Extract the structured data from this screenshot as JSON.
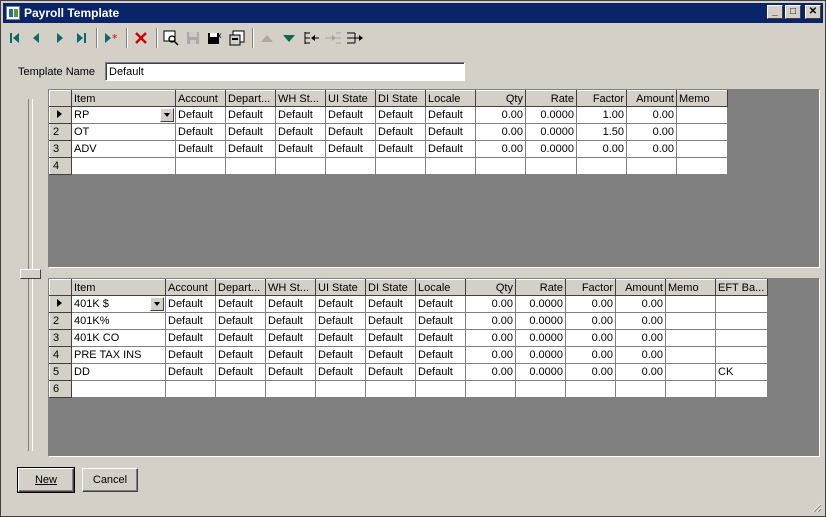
{
  "window": {
    "title": "Payroll Template"
  },
  "toolbar": {
    "icons": [
      "first-record-icon",
      "prev-record-icon",
      "next-record-icon",
      "last-record-icon",
      "new-record-icon",
      "delete-record-icon",
      "find-icon",
      "save-icon",
      "save-close-icon",
      "properties-icon",
      "move-up-icon",
      "move-down-icon",
      "insert-row-icon",
      "indent-icon",
      "outdent-icon"
    ]
  },
  "template_name": {
    "label": "Template Name",
    "value": "Default"
  },
  "grid1": {
    "columns": [
      "Item",
      "Account",
      "Depart...",
      "WH St...",
      "UI State",
      "DI State",
      "Locale",
      "Qty",
      "Rate",
      "Factor",
      "Amount",
      "Memo"
    ],
    "rows": [
      {
        "n": "1",
        "item": "RP",
        "account": "Default",
        "dept": "Default",
        "wh": "Default",
        "ui": "Default",
        "di": "Default",
        "locale": "Default",
        "qty": "0.00",
        "rate": "0.0000",
        "factor": "1.00",
        "amount": "0.00",
        "memo": ""
      },
      {
        "n": "2",
        "item": "OT",
        "account": "Default",
        "dept": "Default",
        "wh": "Default",
        "ui": "Default",
        "di": "Default",
        "locale": "Default",
        "qty": "0.00",
        "rate": "0.0000",
        "factor": "1.50",
        "amount": "0.00",
        "memo": ""
      },
      {
        "n": "3",
        "item": "ADV",
        "account": "Default",
        "dept": "Default",
        "wh": "Default",
        "ui": "Default",
        "di": "Default",
        "locale": "Default",
        "qty": "0.00",
        "rate": "0.0000",
        "factor": "0.00",
        "amount": "0.00",
        "memo": ""
      }
    ],
    "new_row": "4"
  },
  "grid2": {
    "columns": [
      "Item",
      "Account",
      "Depart...",
      "WH St...",
      "UI State",
      "DI State",
      "Locale",
      "Qty",
      "Rate",
      "Factor",
      "Amount",
      "Memo",
      "EFT Ba..."
    ],
    "rows": [
      {
        "n": "1",
        "item": "401K $",
        "account": "Default",
        "dept": "Default",
        "wh": "Default",
        "ui": "Default",
        "di": "Default",
        "locale": "Default",
        "qty": "0.00",
        "rate": "0.0000",
        "factor": "0.00",
        "amount": "0.00",
        "memo": "",
        "eft": ""
      },
      {
        "n": "2",
        "item": "401K%",
        "account": "Default",
        "dept": "Default",
        "wh": "Default",
        "ui": "Default",
        "di": "Default",
        "locale": "Default",
        "qty": "0.00",
        "rate": "0.0000",
        "factor": "0.00",
        "amount": "0.00",
        "memo": "",
        "eft": ""
      },
      {
        "n": "3",
        "item": "401K CO",
        "account": "Default",
        "dept": "Default",
        "wh": "Default",
        "ui": "Default",
        "di": "Default",
        "locale": "Default",
        "qty": "0.00",
        "rate": "0.0000",
        "factor": "0.00",
        "amount": "0.00",
        "memo": "",
        "eft": ""
      },
      {
        "n": "4",
        "item": "PRE TAX INS",
        "account": "Default",
        "dept": "Default",
        "wh": "Default",
        "ui": "Default",
        "di": "Default",
        "locale": "Default",
        "qty": "0.00",
        "rate": "0.0000",
        "factor": "0.00",
        "amount": "0.00",
        "memo": "",
        "eft": ""
      },
      {
        "n": "5",
        "item": "DD",
        "account": "Default",
        "dept": "Default",
        "wh": "Default",
        "ui": "Default",
        "di": "Default",
        "locale": "Default",
        "qty": "0.00",
        "rate": "0.0000",
        "factor": "0.00",
        "amount": "0.00",
        "memo": "",
        "eft": "CK"
      }
    ],
    "new_row": "6"
  },
  "buttons": {
    "new": "New",
    "cancel": "Cancel"
  }
}
